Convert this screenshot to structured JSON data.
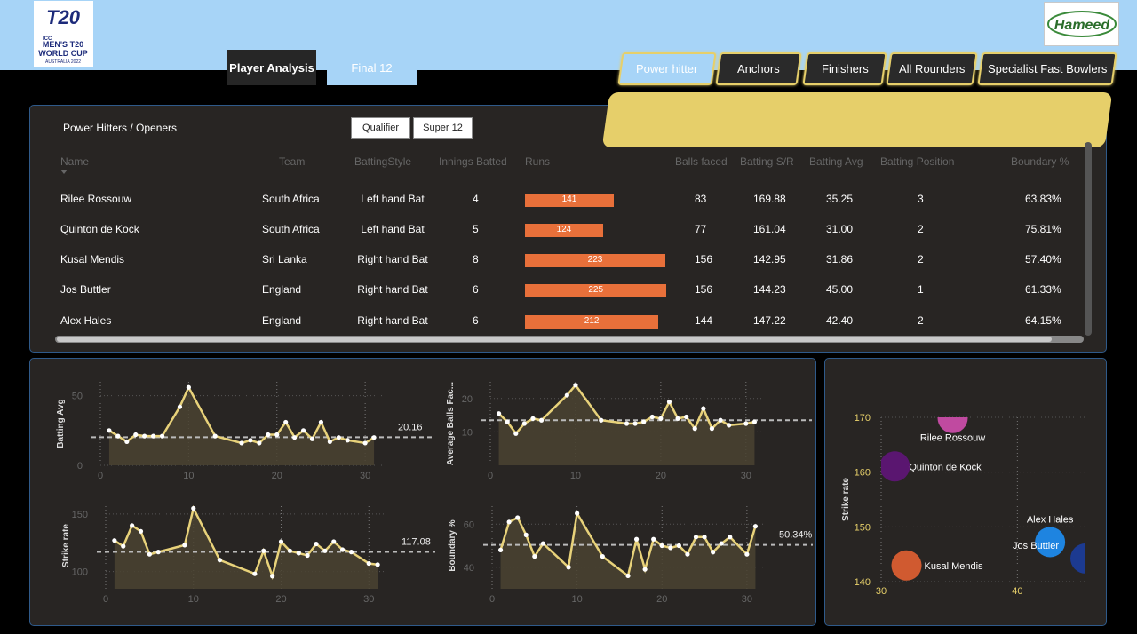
{
  "header": {
    "logo_icc_text": [
      "ICC",
      "MEN'S T20",
      "WORLD CUP",
      "AUSTRALIA 2022"
    ],
    "logo_hameed_text": "Hameed",
    "tabs": [
      {
        "label": "Player Analysis"
      },
      {
        "label": "Final 12"
      }
    ],
    "categories": [
      {
        "label": "Power hitter"
      },
      {
        "label": "Anchors"
      },
      {
        "label": "Finishers"
      },
      {
        "label": "All Rounders"
      },
      {
        "label": "Specialist Fast Bowlers"
      }
    ]
  },
  "table": {
    "title": "Power Hitters / Openers",
    "filters": [
      "Qualifier",
      "Super 12"
    ],
    "columns": [
      "Name",
      "Team",
      "BattingStyle",
      "Innings Batted",
      "Runs",
      "Balls faced",
      "Batting S/R",
      "Batting Avg",
      "Batting Position",
      "Boundary %"
    ],
    "rows": [
      {
        "name": "Rilee Rossouw",
        "team": "South Africa",
        "style": "Left hand Bat",
        "innings": "4",
        "runs": 141,
        "balls": "83",
        "sr": "169.88",
        "avg": "35.25",
        "pos": "3",
        "boundary": "63.83%"
      },
      {
        "name": "Quinton de Kock",
        "team": "South Africa",
        "style": "Left hand Bat",
        "innings": "5",
        "runs": 124,
        "balls": "77",
        "sr": "161.04",
        "avg": "31.00",
        "pos": "2",
        "boundary": "75.81%"
      },
      {
        "name": "Kusal Mendis",
        "team": "Sri Lanka",
        "style": "Right hand Bat",
        "innings": "8",
        "runs": 223,
        "balls": "156",
        "sr": "142.95",
        "avg": "31.86",
        "pos": "2",
        "boundary": "57.40%"
      },
      {
        "name": "Jos Buttler",
        "team": "England",
        "style": "Right hand Bat",
        "innings": "6",
        "runs": 225,
        "balls": "156",
        "sr": "144.23",
        "avg": "45.00",
        "pos": "1",
        "boundary": "61.33%"
      },
      {
        "name": "Alex Hales",
        "team": "England",
        "style": "Right hand Bat",
        "innings": "6",
        "runs": 212,
        "balls": "144",
        "sr": "147.22",
        "avg": "42.40",
        "pos": "2",
        "boundary": "64.15%"
      }
    ]
  },
  "colors": {
    "accent_yellow": "#e6cf6a",
    "runs_bar": "#e8703a",
    "line": "#e8d27a",
    "area": "#4a4331",
    "panel": "#282523",
    "header": "#a7d4f7"
  },
  "chart_data": [
    {
      "type": "area",
      "ylabel": "Batting Avg",
      "ylim": [
        0,
        60
      ],
      "xlim": [
        0,
        32
      ],
      "yticks": [
        0,
        50
      ],
      "xticks": [
        0,
        10,
        20,
        30
      ],
      "ref_value": 20.16,
      "ref_label": "20.16",
      "x": [
        1,
        2,
        3,
        4,
        5,
        6,
        7,
        9,
        10,
        13,
        16,
        17,
        18,
        19,
        20,
        21,
        22,
        23,
        24,
        25,
        26,
        27,
        28,
        30,
        31
      ],
      "values": [
        25,
        21,
        17,
        22,
        21,
        21,
        21,
        42,
        56,
        21,
        16,
        18,
        16,
        22,
        22,
        31,
        20,
        25,
        19,
        31,
        17,
        20,
        18,
        16,
        20
      ]
    },
    {
      "type": "area",
      "ylabel": "Average Balls Fac...",
      "ylim": [
        0,
        25
      ],
      "xlim": [
        0,
        32
      ],
      "yticks": [
        10,
        20
      ],
      "xticks": [
        0,
        10,
        20,
        30
      ],
      "ref_value": 13.5,
      "ref_label": "",
      "x": [
        1,
        2,
        3,
        4,
        5,
        6,
        9,
        10,
        13,
        16,
        17,
        18,
        19,
        20,
        21,
        22,
        23,
        24,
        25,
        26,
        27,
        28,
        30,
        31
      ],
      "values": [
        15.5,
        13,
        9.5,
        12.5,
        14,
        13.5,
        21,
        24,
        13.5,
        12.5,
        12.5,
        13,
        14.5,
        14,
        19,
        14,
        14.5,
        11,
        17,
        11,
        13.5,
        12,
        12.5,
        13
      ]
    },
    {
      "type": "area",
      "ylabel": "Strike rate",
      "ylim": [
        85,
        160
      ],
      "xlim": [
        0,
        32
      ],
      "yticks": [
        100,
        150
      ],
      "xticks": [
        0,
        10,
        20,
        30
      ],
      "ref_value": 117.08,
      "ref_label": "117.08",
      "x": [
        1,
        2,
        3,
        4,
        5,
        6,
        9,
        10,
        13,
        17,
        18,
        19,
        20,
        21,
        22,
        23,
        24,
        25,
        26,
        27,
        28,
        30,
        31
      ],
      "values": [
        127,
        122,
        140,
        135,
        115,
        117,
        123,
        155,
        110,
        98,
        118,
        96,
        126,
        118,
        116,
        114,
        124,
        118,
        126,
        119,
        117,
        107,
        106,
        128
      ]
    },
    {
      "type": "area",
      "ylabel": "Boundary %",
      "ylim": [
        30,
        70
      ],
      "xlim": [
        0,
        32
      ],
      "yticks": [
        40,
        60
      ],
      "xticks": [
        0,
        10,
        20,
        30
      ],
      "ref_value": 50.34,
      "ref_label": "50.34%",
      "x": [
        1,
        2,
        3,
        4,
        5,
        6,
        9,
        10,
        13,
        16,
        17,
        18,
        19,
        20,
        21,
        22,
        23,
        24,
        25,
        26,
        27,
        28,
        30,
        31
      ],
      "values": [
        48,
        61,
        63,
        55,
        45,
        51,
        40,
        65,
        45,
        36,
        53,
        39,
        53,
        50,
        49,
        50,
        46,
        54,
        54,
        47,
        51,
        54,
        46,
        59
      ]
    },
    {
      "type": "scatter",
      "ylabel": "Strike rate",
      "xlim": [
        30,
        45
      ],
      "ylim": [
        140,
        170
      ],
      "xticks": [
        30,
        40
      ],
      "yticks": [
        140,
        150,
        160,
        170
      ],
      "points": [
        {
          "name": "Rilee Rossouw",
          "x": 35.25,
          "y": 169.88,
          "color": "#c04aa0"
        },
        {
          "name": "Quinton de Kock",
          "x": 31.0,
          "y": 161.04,
          "color": "#5a1670"
        },
        {
          "name": "Kusal Mendis",
          "x": 31.86,
          "y": 142.95,
          "color": "#d05a30"
        },
        {
          "name": "Jos Buttler",
          "x": 45.0,
          "y": 144.23,
          "color": "#1c3a90"
        },
        {
          "name": "Alex Hales",
          "x": 42.4,
          "y": 147.22,
          "color": "#1e84e0"
        }
      ]
    }
  ]
}
